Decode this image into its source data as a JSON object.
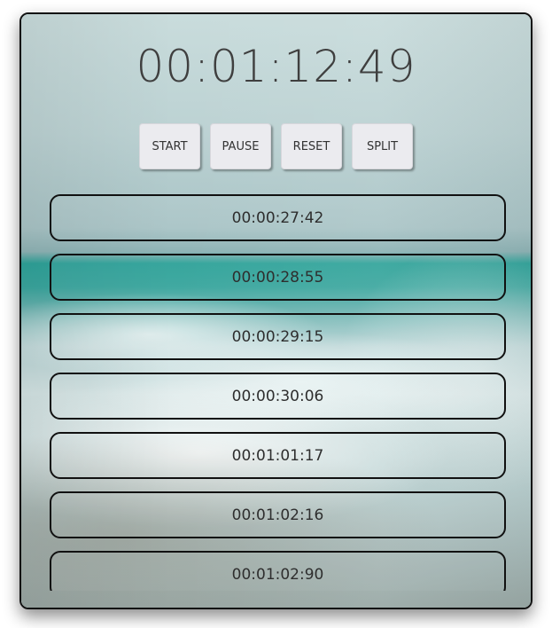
{
  "stopwatch": {
    "display": "00:01:12:49"
  },
  "controls": {
    "start_label": "START",
    "pause_label": "PAUSE",
    "reset_label": "RESET",
    "split_label": "SPLIT"
  },
  "laps": [
    "00:00:27:42",
    "00:00:28:55",
    "00:00:29:15",
    "00:00:30:06",
    "00:01:01:17",
    "00:01:02:16",
    "00:01:02:90"
  ]
}
